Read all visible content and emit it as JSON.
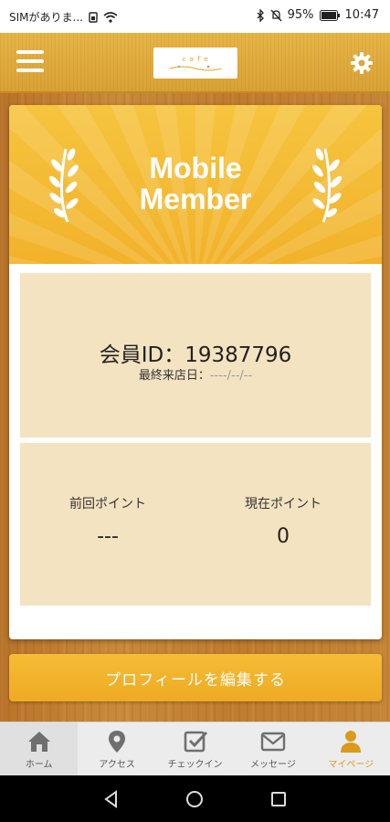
{
  "status_bar": {
    "carrier": "SIMがありま...",
    "battery": "95%",
    "time": "10:47"
  },
  "header": {
    "logo_line1": "ｃａｆｅ",
    "logo_line2": "",
    "icons": [
      "menu-icon",
      "gear-icon"
    ]
  },
  "banner": {
    "title_line1": "Mobile",
    "title_line2": "Member"
  },
  "member": {
    "id_label": "会員ID：",
    "id_value": "19387796",
    "last_visit_label": "最終来店日：",
    "last_visit_value": "----/--/--"
  },
  "points": {
    "previous_label": "前回ポイント",
    "previous_value": "---",
    "current_label": "現在ポイント",
    "current_value": "0"
  },
  "profile_button": "プロフィールを編集する",
  "tabs": [
    {
      "label": "ホーム",
      "icon": "home-icon",
      "active": false
    },
    {
      "label": "アクセス",
      "icon": "location-pin-icon",
      "active": false
    },
    {
      "label": "チェックイン",
      "icon": "checkin-icon",
      "active": false
    },
    {
      "label": "メッセージ",
      "icon": "mail-icon",
      "active": false
    },
    {
      "label": "マイページ",
      "icon": "person-icon",
      "active": true
    }
  ],
  "colors": {
    "accent": "#f2b22a",
    "panel": "#f4e3c0",
    "active_tab": "#d99a1e"
  }
}
